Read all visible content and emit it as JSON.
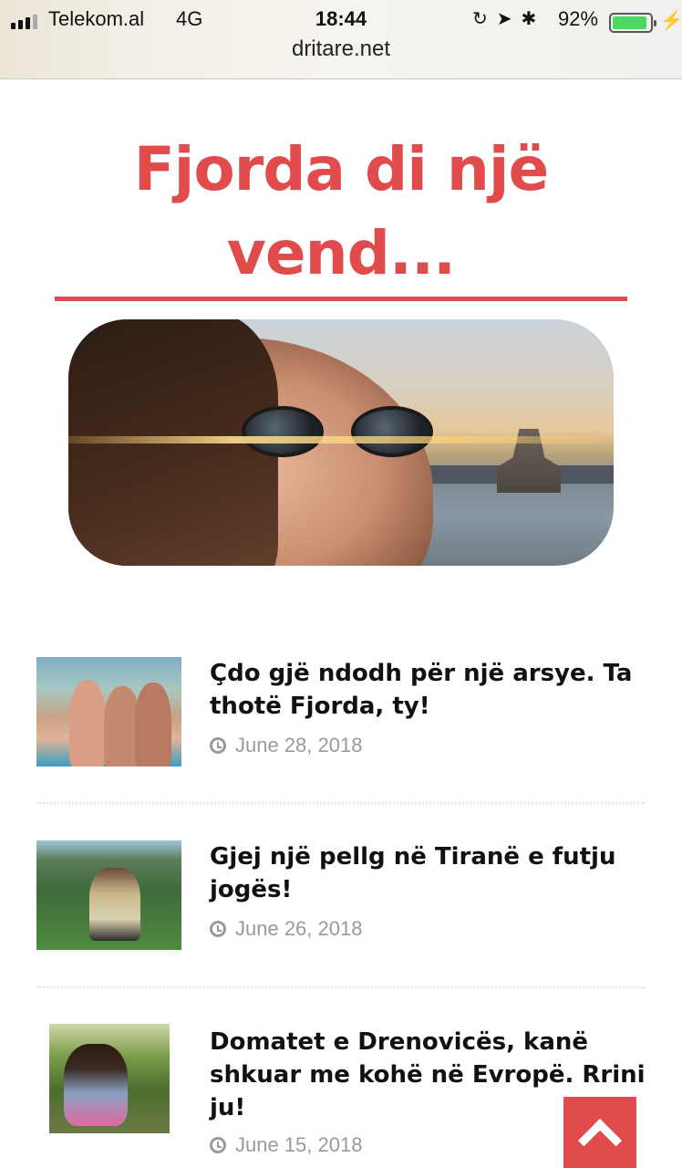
{
  "status_bar": {
    "carrier": "Telekom.al",
    "network": "4G",
    "time": "18:44",
    "battery_percent": "92%",
    "battery_level": 0.92,
    "icons": [
      "signal-icon",
      "rotation-lock-icon",
      "location-icon",
      "bluetooth-icon",
      "battery-icon",
      "charging-icon"
    ]
  },
  "browser": {
    "url": "dritare.net"
  },
  "hero": {
    "title": "Fjorda di një vend...",
    "image": "woman-sunglasses-lighthouse-photo"
  },
  "posts": [
    {
      "title": "Çdo gjë ndodh për një arsye. Ta thotë Fjorda, ty!",
      "date": "June 28, 2018",
      "thumbnail": "women-on-boat-photo"
    },
    {
      "title": "Gjej një pellg në Tiranë e futju jogës!",
      "date": "June 26, 2018",
      "thumbnail": "yoga-outdoor-photo"
    },
    {
      "title": "Domatet e Drenovicës, kanë shkuar me kohë në Evropë. Rrini ju!",
      "date": "June 15, 2018",
      "thumbnail": "woman-in-tomato-garden-photo"
    }
  ],
  "scroll_top": {
    "icon": "chevron-up-icon"
  },
  "colors": {
    "accent": "#e24b4b",
    "date_gray": "#9a9a9a",
    "text": "#111111"
  }
}
